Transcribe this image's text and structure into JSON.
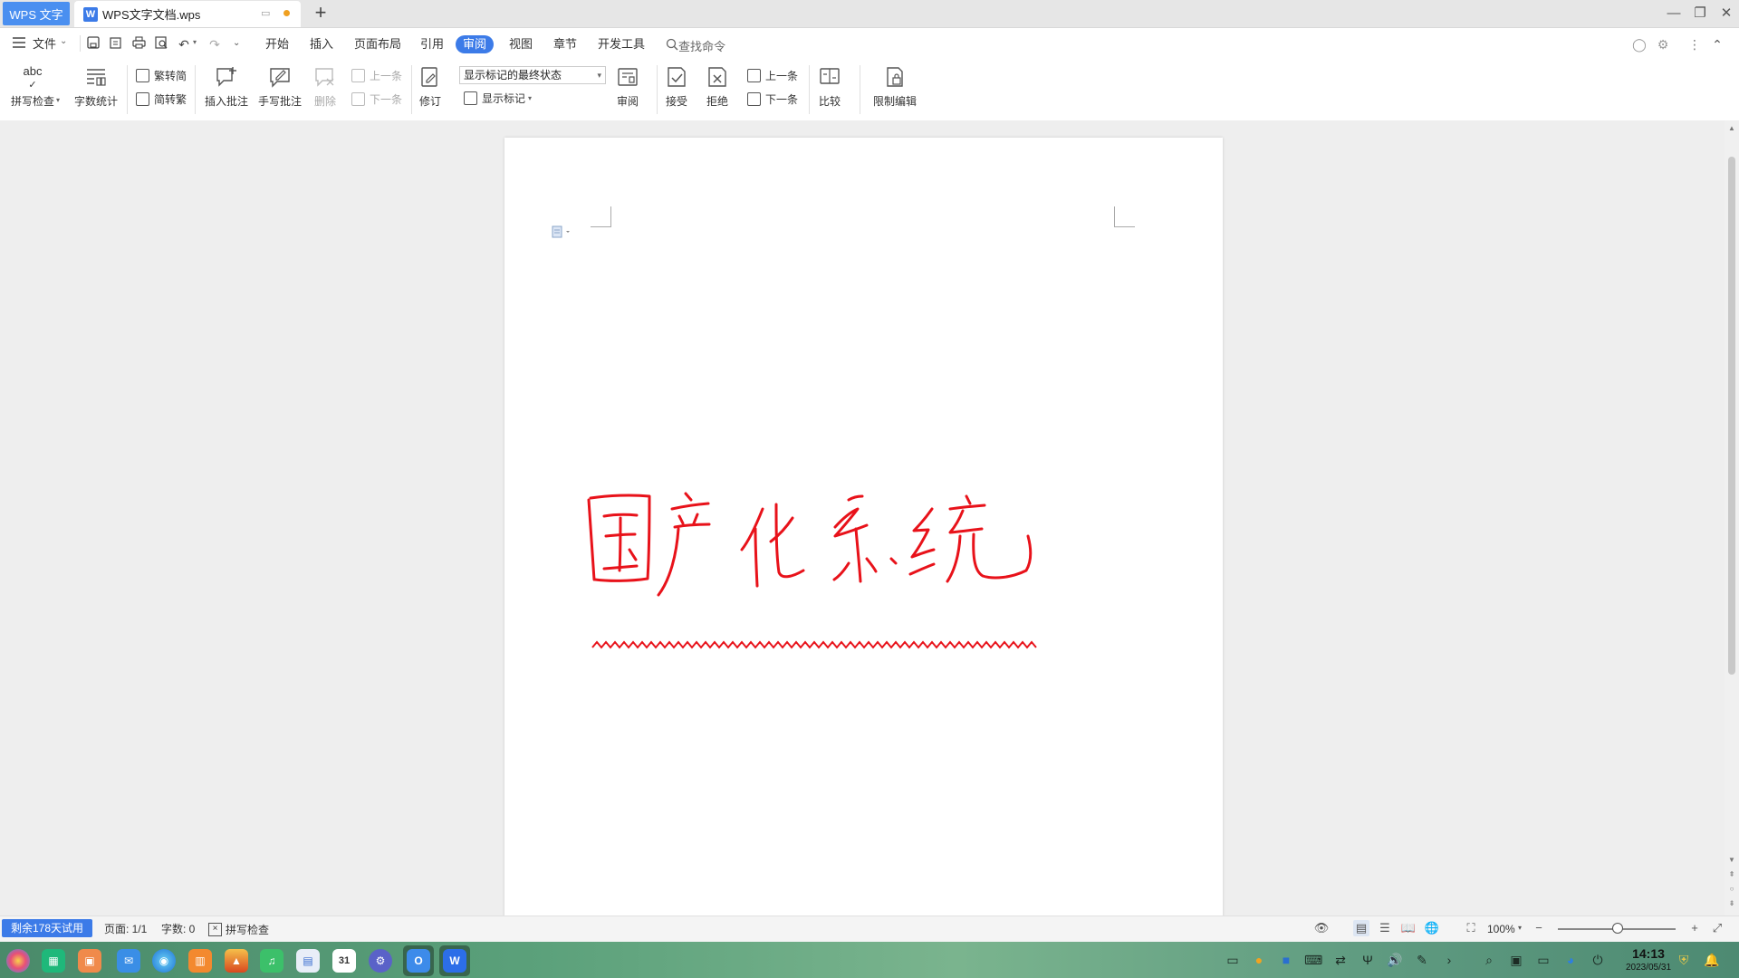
{
  "titlebar": {
    "app_badge": "WPS 文字",
    "doc_tab_title": "WPS文字文档.wps",
    "new_tab": "+",
    "win_minimize": "—",
    "win_restore": "❐",
    "win_close": "✕"
  },
  "menubar": {
    "file_label": "文件",
    "tabs": [
      "开始",
      "插入",
      "页面布局",
      "引用",
      "审阅",
      "视图",
      "章节",
      "开发工具"
    ],
    "active_tab": "审阅",
    "search_label": "查找命令"
  },
  "ribbon": {
    "spell_check": "拼写检查",
    "spell_icon_text": "abc",
    "word_count": "字数统计",
    "trad_to_simp": "繁转简",
    "simp_to_trad": "简转繁",
    "insert_comment": "插入批注",
    "handwrite_comment": "手写批注",
    "delete": "删除",
    "prev_comment": "上一条",
    "next_comment": "下一条",
    "revise": "修订",
    "markup_state": "显示标记的最终状态",
    "show_markup": "显示标记",
    "review_pane": "审阅",
    "accept": "接受",
    "reject": "拒绝",
    "prev_change": "上一条",
    "next_change": "下一条",
    "compare": "比较",
    "restrict_edit": "限制编辑"
  },
  "document": {
    "handwriting_text": "国产化系统",
    "ink_color": "#e8121a"
  },
  "statusbar": {
    "trial": "剩余178天试用",
    "page": "页面: 1/1",
    "word_count": "字数: 0",
    "spell_check": "拼写检查",
    "zoom": "100%"
  },
  "taskbar": {
    "time": "14:13",
    "date": "2023/05/31",
    "calendar_day": "31"
  },
  "colors": {
    "accent": "#3c7be8",
    "ink": "#e8121a"
  }
}
